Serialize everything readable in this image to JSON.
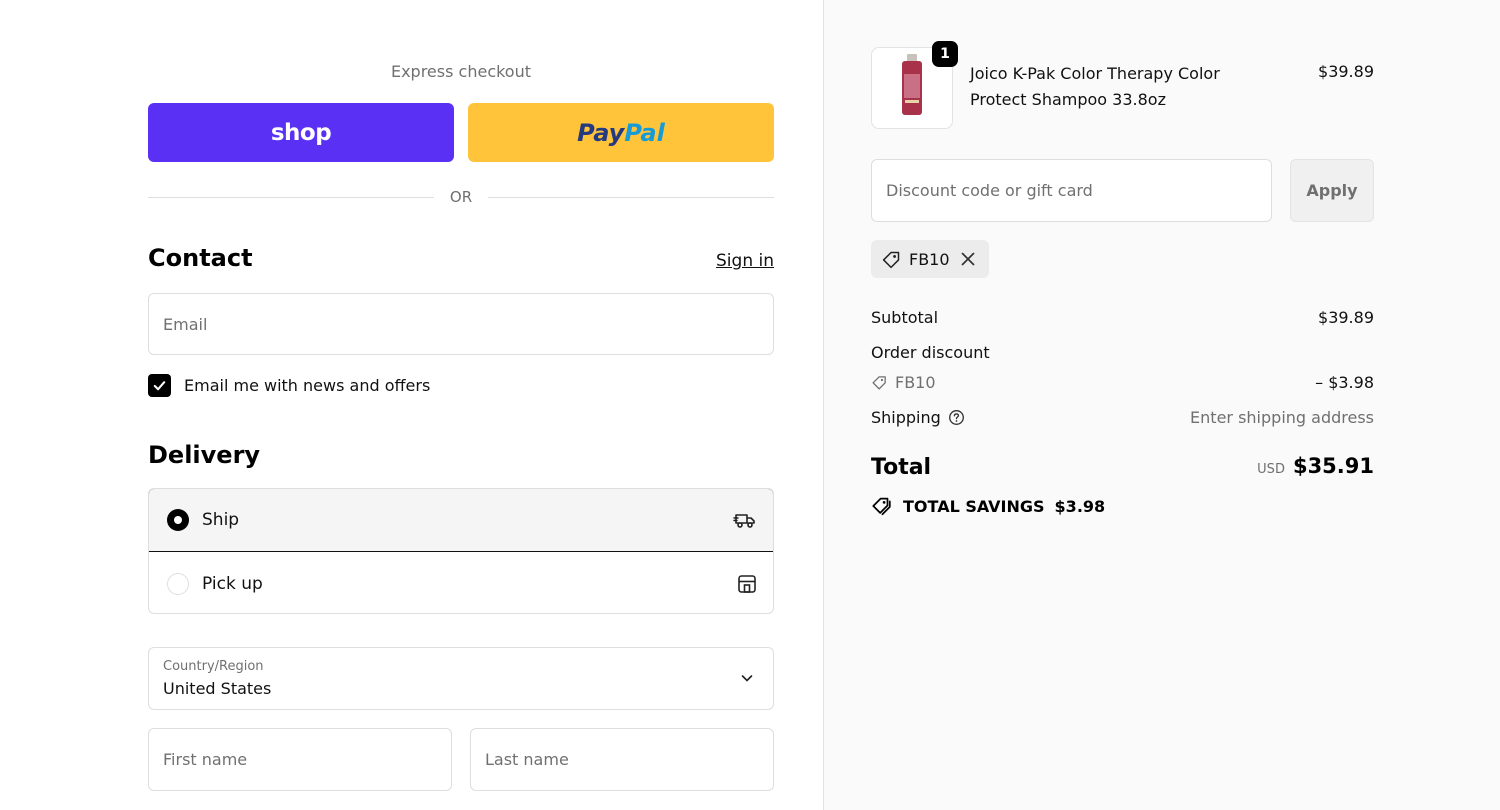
{
  "express": {
    "label": "Express checkout",
    "shop_label": "shop",
    "paypal_dark": "Pay",
    "paypal_light": "Pal",
    "or": "OR"
  },
  "contact": {
    "title": "Contact",
    "sign_in": "Sign in",
    "email_placeholder": "Email",
    "newsletter_label": "Email me with news and offers",
    "newsletter_checked": true
  },
  "delivery": {
    "title": "Delivery",
    "options": [
      {
        "label": "Ship",
        "selected": true,
        "icon": "truck-icon"
      },
      {
        "label": "Pick up",
        "selected": false,
        "icon": "store-icon"
      }
    ],
    "country_caption": "Country/Region",
    "country_value": "United States",
    "first_name_placeholder": "First name",
    "last_name_placeholder": "Last name"
  },
  "summary": {
    "item": {
      "quantity": "1",
      "name": "Joico K-Pak Color Therapy Color Protect Shampoo 33.8oz",
      "price": "$39.89"
    },
    "discount_placeholder": "Discount code or gift card",
    "apply_label": "Apply",
    "applied_code": "FB10",
    "subtotal_label": "Subtotal",
    "subtotal_value": "$39.89",
    "order_discount_label": "Order discount",
    "discount_code": "FB10",
    "discount_value": "– $3.98",
    "shipping_label": "Shipping",
    "shipping_value": "Enter shipping address",
    "total_label": "Total",
    "currency": "USD",
    "total_value": "$35.91",
    "savings_label": "TOTAL SAVINGS",
    "savings_value": "$3.98"
  },
  "colors": {
    "shop_purple": "#5a31f4",
    "paypal_yellow": "#ffc439",
    "summary_bg": "#fafafa"
  }
}
